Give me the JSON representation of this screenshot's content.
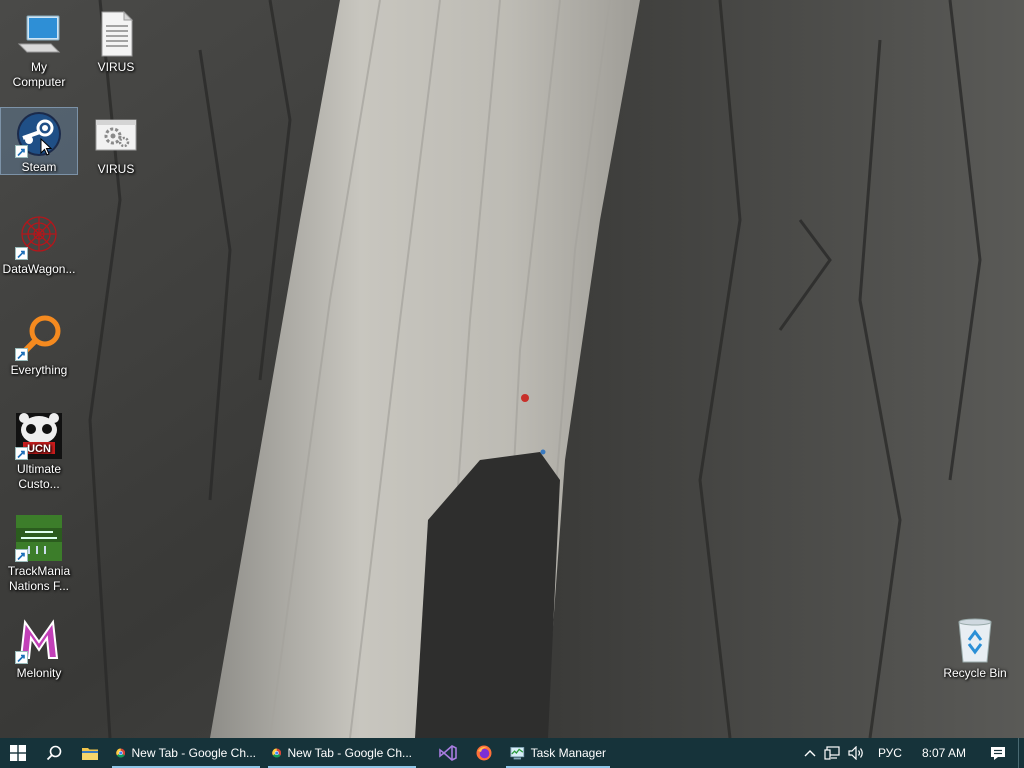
{
  "desktop": {
    "icons": [
      {
        "label": "My Computer",
        "icon": "computer-icon"
      },
      {
        "label": "VIRUS",
        "icon": "text-file-icon"
      },
      {
        "label": "Steam",
        "icon": "steam-icon",
        "selected": true
      },
      {
        "label": "VIRUS",
        "icon": "settings-file-icon"
      },
      {
        "label": "DataWagon...",
        "icon": "datawagon-icon"
      },
      {
        "label": "Everything",
        "icon": "everything-search-icon"
      },
      {
        "label": "Ultimate Custo...",
        "icon": "ucn-icon"
      },
      {
        "label": "TrackMania Nations F...",
        "icon": "trackmania-icon"
      },
      {
        "label": "Melonity",
        "icon": "melonity-icon"
      },
      {
        "label": "Recycle Bin",
        "icon": "recycle-bin-icon"
      }
    ]
  },
  "taskbar": {
    "apps": [
      {
        "label": "New Tab - Google Ch...",
        "icon": "chrome-icon"
      },
      {
        "label": "New Tab - Google Ch...",
        "icon": "chrome-icon"
      },
      {
        "label": "",
        "icon": "visual-studio-icon"
      },
      {
        "label": "",
        "icon": "firefox-icon"
      },
      {
        "label": "Task Manager",
        "icon": "task-manager-icon"
      }
    ],
    "tray": {
      "language": "РУС",
      "time": "8:07 AM"
    }
  },
  "colors": {
    "taskbar_bg": "#16333a",
    "selection": "#78aadc"
  }
}
